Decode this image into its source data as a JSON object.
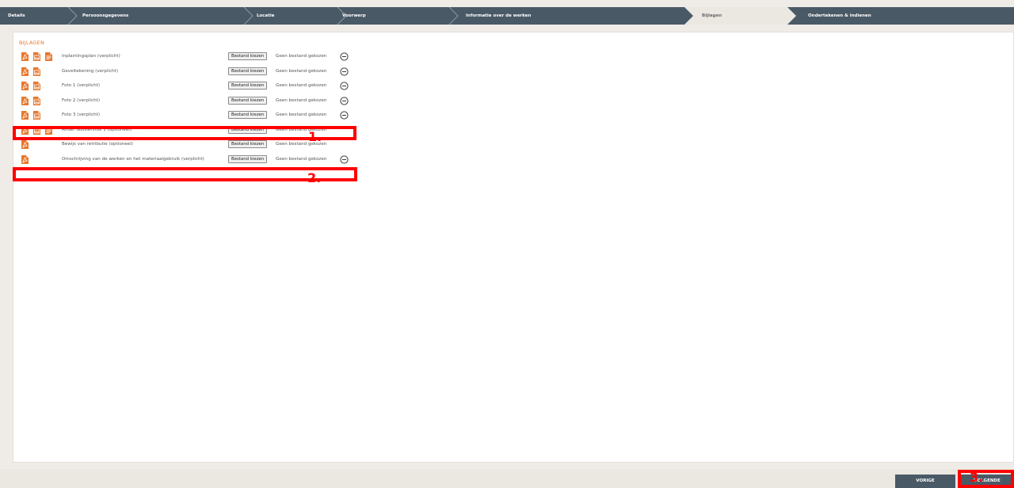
{
  "stepper": {
    "steps": [
      {
        "label": "Details"
      },
      {
        "label": "Persoonsgegevens"
      },
      {
        "label": "Locatie"
      },
      {
        "label": "Voorwerp"
      },
      {
        "label": "Informatie over de werken"
      },
      {
        "label": "Bijlagen"
      },
      {
        "label": "Ondertekenen & indienen"
      }
    ],
    "active": "Bijlagen"
  },
  "section": {
    "title": "BIJLAGEN"
  },
  "attachments": [
    {
      "label": "Inplantingsplan (verplicht)",
      "icons": [
        "pdf-icon",
        "image-icon",
        "document-icon"
      ],
      "button": "Bestand kiezen",
      "status": "Geen bestand gekozen",
      "removable": true
    },
    {
      "label": "Geveltekening (verplicht)",
      "icons": [
        "pdf-icon",
        "image-icon"
      ],
      "button": "Bestand kiezen",
      "status": "Geen bestand gekozen",
      "removable": true
    },
    {
      "label": "Foto 1 (verplicht)",
      "icons": [
        "pdf-icon",
        "image-icon"
      ],
      "button": "Bestand kiezen",
      "status": "Geen bestand gekozen",
      "removable": true
    },
    {
      "label": "Foto 2 (verplicht)",
      "icons": [
        "pdf-icon",
        "image-icon"
      ],
      "button": "Bestand kiezen",
      "status": "Geen bestand gekozen",
      "removable": true
    },
    {
      "label": "Foto 3 (verplicht)",
      "icons": [
        "pdf-icon",
        "image-icon"
      ],
      "button": "Bestand kiezen",
      "status": "Geen bestand gekozen",
      "removable": true
    },
    {
      "label": "Ander dossierstuk 1 (optioneel)",
      "icons": [
        "pdf-icon",
        "image-icon",
        "document-icon"
      ],
      "button": "Bestand kiezen",
      "status": "Geen bestand gekozen",
      "removable": false
    },
    {
      "label": "Bewijs van retributie (optioneel)",
      "icons": [
        "pdf-icon"
      ],
      "button": "Bestand kiezen",
      "status": "Geen bestand gekozen",
      "removable": false
    },
    {
      "label": "Omschrijving van de werken en het materiaalgebruik (verplicht)",
      "icons": [
        "pdf-icon"
      ],
      "button": "Bestand kiezen",
      "status": "Geen bestand gekozen",
      "removable": true
    }
  ],
  "annotations": {
    "one": "1.",
    "two": "2.",
    "three": "3."
  },
  "footer": {
    "previous": "VORIGE",
    "next": "VOLGENDE"
  },
  "colors": {
    "stepper_bg": "#4a5966",
    "accent_orange": "#e6782d",
    "page_bg": "#efebe6",
    "highlight_red": "#ff0000"
  }
}
